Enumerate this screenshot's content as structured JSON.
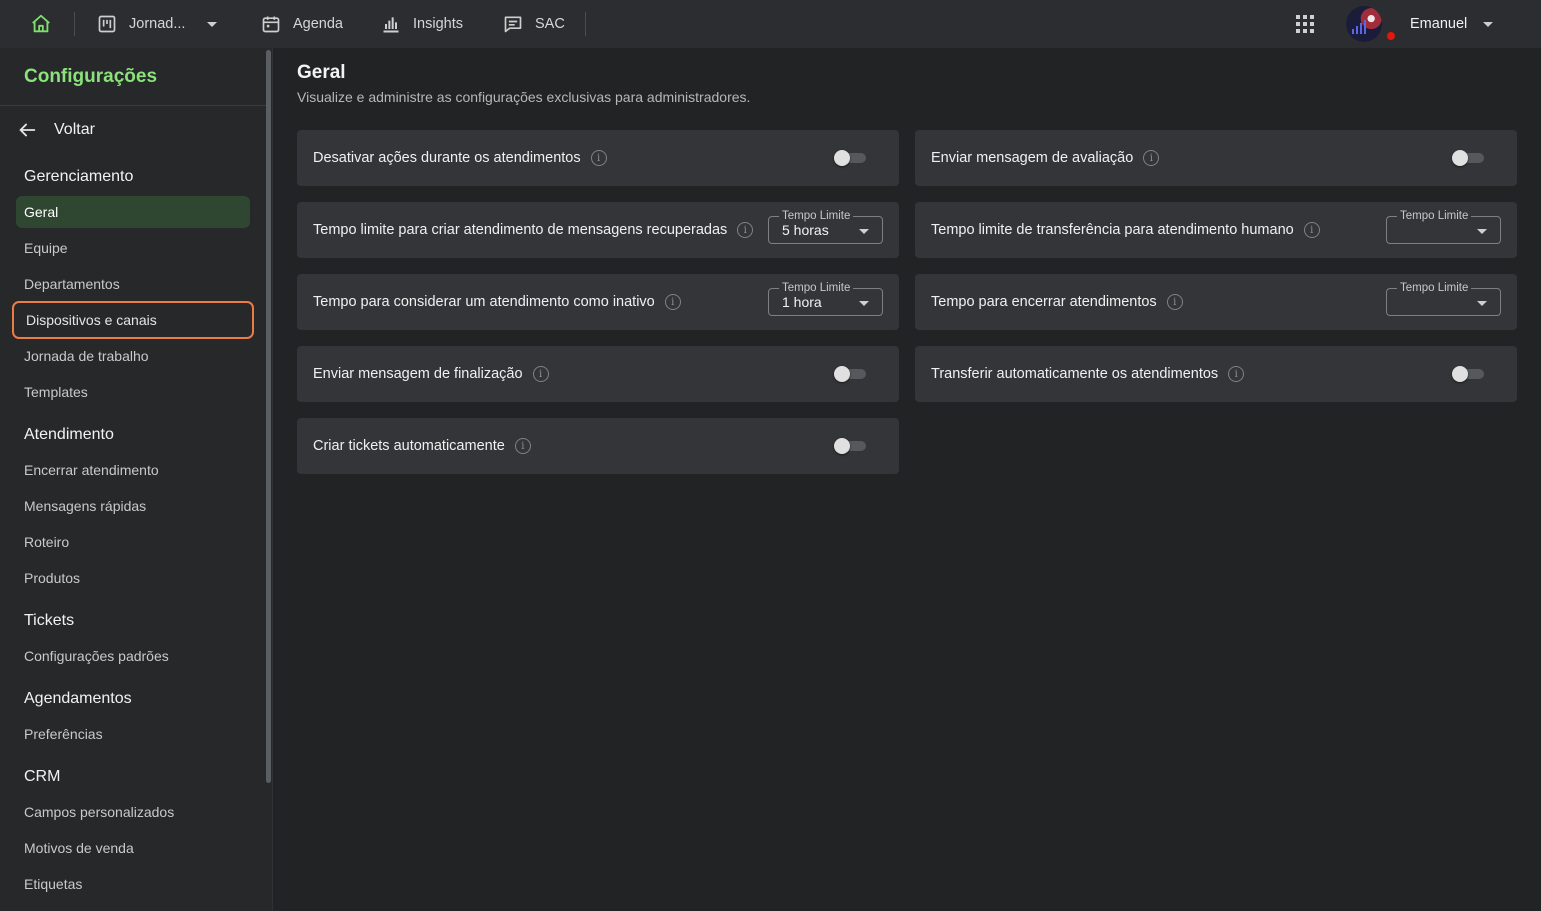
{
  "topbar": {
    "items": [
      {
        "label": "Jornad...",
        "icon": "kanban-icon"
      },
      {
        "label": "Agenda",
        "icon": "calendar-icon"
      },
      {
        "label": "Insights",
        "icon": "bar-chart-icon"
      },
      {
        "label": "SAC",
        "icon": "chat-icon"
      }
    ],
    "user_name": "Emanuel"
  },
  "sidebar": {
    "title": "Configurações",
    "back_label": "Voltar",
    "sections": {
      "gerenciamento": "Gerenciamento",
      "atendimento": "Atendimento",
      "tickets": "Tickets",
      "agendamentos": "Agendamentos",
      "crm": "CRM"
    },
    "items": {
      "geral": "Geral",
      "equipe": "Equipe",
      "departamentos": "Departamentos",
      "dispositivos": "Dispositivos e canais",
      "jornada": "Jornada de trabalho",
      "templates": "Templates",
      "encerrar": "Encerrar atendimento",
      "mensagens": "Mensagens rápidas",
      "roteiro": "Roteiro",
      "produtos": "Produtos",
      "config_padroes": "Configurações padrões",
      "preferencias": "Preferências",
      "campos": "Campos personalizados",
      "motivos": "Motivos de venda",
      "etiquetas": "Etiquetas"
    }
  },
  "main": {
    "title": "Geral",
    "subtitle": "Visualize e administre as configurações exclusivas para administradores.",
    "settings": {
      "desativar": {
        "label": "Desativar ações durante os atendimentos",
        "enabled": false
      },
      "avaliacao": {
        "label": "Enviar mensagem de avaliação",
        "enabled": false
      },
      "tempo_recuperadas": {
        "label": "Tempo limite para criar atendimento de mensagens recuperadas",
        "select_label": "Tempo Limite",
        "value": "5 horas"
      },
      "tempo_transferencia": {
        "label": "Tempo limite de transferência para atendimento humano",
        "select_label": "Tempo Limite",
        "value": ""
      },
      "tempo_inativo": {
        "label": "Tempo para considerar um atendimento como inativo",
        "select_label": "Tempo Limite",
        "value": "1 hora"
      },
      "tempo_encerrar": {
        "label": "Tempo para encerrar atendimentos",
        "select_label": "Tempo Limite",
        "value": ""
      },
      "finalizacao": {
        "label": "Enviar mensagem de finalização",
        "enabled": false
      },
      "transferir_auto": {
        "label": "Transferir automaticamente os atendimentos",
        "enabled": false
      },
      "tickets_auto": {
        "label": "Criar tickets automaticamente",
        "enabled": false
      }
    }
  },
  "colors": {
    "accent": "#8be27a",
    "active_item_bg": "#2f4631",
    "focus_outline": "#ec7b45",
    "status_dot": "#e3170a"
  }
}
